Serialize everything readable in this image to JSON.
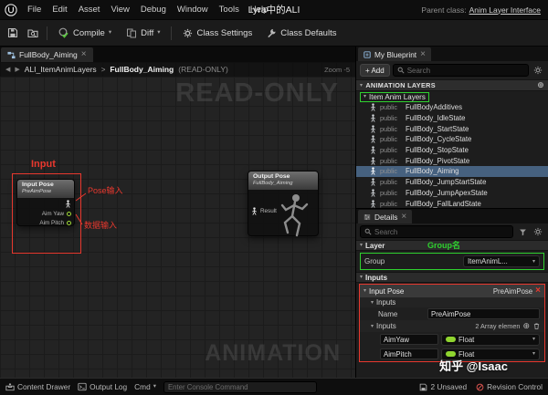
{
  "colors": {
    "annotation_red": "#e8382e",
    "annotation_green": "#2fd12f",
    "selection_blue": "#46617f",
    "float_green": "#8fd42f"
  },
  "icons": {
    "chevron_down": "▾",
    "chevron_right": "▸",
    "back": "◀",
    "forward": "▶",
    "close": "×",
    "plus_circle": "⊕"
  },
  "menubar": {
    "items": [
      "File",
      "Edit",
      "Asset",
      "View",
      "Debug",
      "Window",
      "Tools",
      "Help"
    ],
    "title": "Lyra中的ALI",
    "parent_class_label": "Parent class:",
    "parent_class_value": "Anim Layer Interface"
  },
  "toolbar": {
    "compile_label": "Compile",
    "diff_label": "Diff",
    "class_settings_label": "Class Settings",
    "class_defaults_label": "Class Defaults"
  },
  "graph": {
    "tab_label": "FullBody_Aiming",
    "breadcrumb": {
      "root": "ALI_ItemAnimLayers",
      "separator": ">",
      "current": "FullBody_Aiming",
      "suffix": "(READ-ONLY)"
    },
    "zoom_label": "Zoom -5",
    "watermark_top": "READ-ONLY",
    "watermark_bottom": "ANIMATION",
    "input_node": {
      "title": "Input Pose",
      "subtitle": "PreAimPose",
      "pins": [
        "Aim Yaw",
        "Aim Pitch"
      ]
    },
    "output_node": {
      "title": "Output Pose",
      "subtitle": "FullBody_Aiming",
      "result_pin": "Result"
    },
    "annotations": {
      "input_label": "Input",
      "pose_input": "Pose输入",
      "data_input": "数据输入"
    }
  },
  "my_blueprint": {
    "tab_label": "My Blueprint",
    "add_button": "+ Add",
    "search_placeholder": "Search",
    "section_label": "ANIMATION LAYERS",
    "group_label": "Item Anim Layers",
    "visibility": "public",
    "selected_layer": "FullBody_Aiming",
    "layers": [
      "FullBodyAdditives",
      "FullBody_IdleState",
      "FullBody_StartState",
      "FullBody_CycleState",
      "FullBody_StopState",
      "FullBody_PivotState",
      "FullBody_Aiming",
      "FullBody_JumpStartState",
      "FullBody_JumpApexState",
      "FullBody_FallLandState"
    ]
  },
  "details": {
    "tab_label": "Details",
    "search_placeholder": "Search",
    "layer_section_label": "Layer",
    "group_annotation": "Group名",
    "group_label": "Group",
    "group_value": "ItemAnimL...",
    "inputs_section_label": "Inputs",
    "input_pose": {
      "label": "Input Pose",
      "value": "PreAimPose"
    },
    "inputs_sub_label": "Inputs",
    "name_label": "Name",
    "name_value": "PreAimPose",
    "array_label": "Inputs",
    "array_info": "2 Array elemen",
    "elements": [
      {
        "name": "AimYaw",
        "type": "Float"
      },
      {
        "name": "AimPitch",
        "type": "Float"
      }
    ]
  },
  "statusbar": {
    "content_drawer": "Content Drawer",
    "output_log": "Output Log",
    "cmd_label": "Cmd",
    "console_placeholder": "Enter Console Command",
    "unsaved_label": "2 Unsaved",
    "revision_label": "Revision Control"
  },
  "watermark_credit": "知乎 @Isaac"
}
